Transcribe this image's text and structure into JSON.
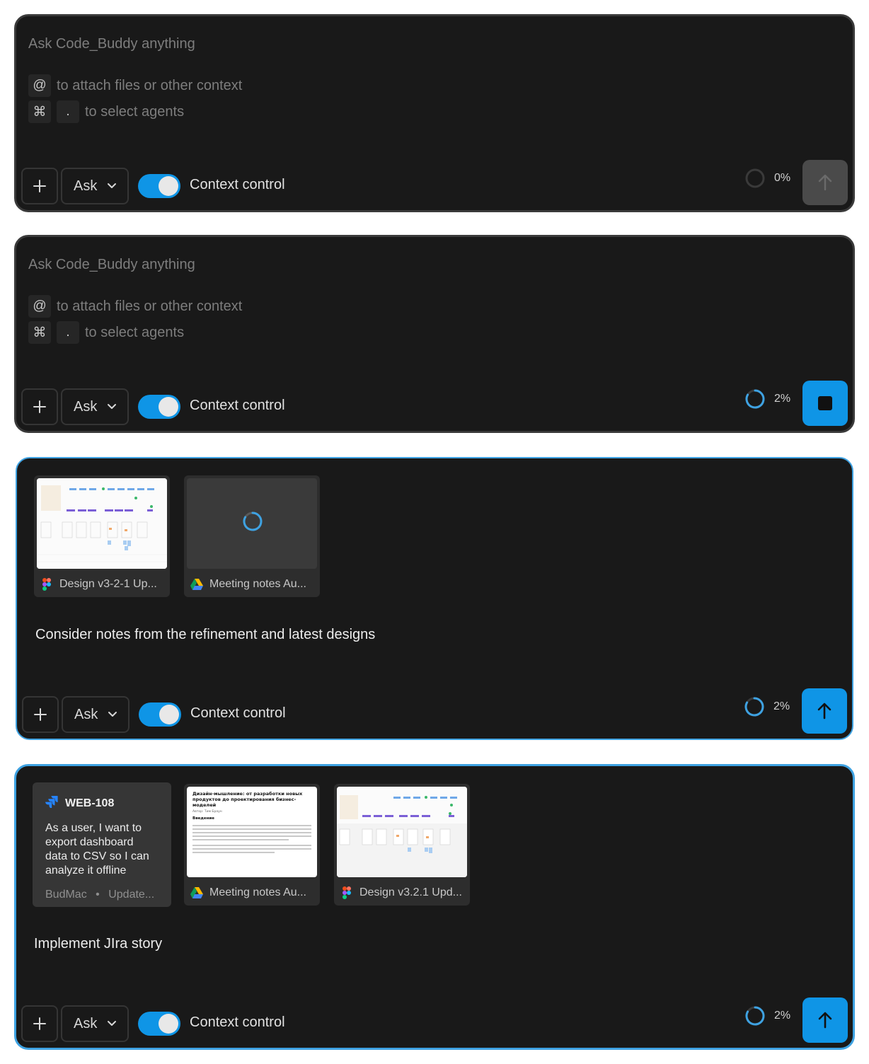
{
  "common": {
    "placeholder": "Ask Code_Buddy anything",
    "hint_attach_key": "@",
    "hint_attach_text": "to attach files or other context",
    "hint_agents_key1": "⌘",
    "hint_agents_key2": ".",
    "hint_agents_text": "to select agents",
    "mode_label": "Ask",
    "toggle_label": "Context control",
    "toggle_on": true
  },
  "panels": [
    {
      "state": "idle",
      "context_usage": "0%",
      "send_state": "disabled"
    },
    {
      "state": "generating",
      "context_usage": "2%",
      "send_state": "stop"
    },
    {
      "state": "composing",
      "attachments": [
        {
          "type": "figma",
          "label": "Design v3-2-1 Up..."
        },
        {
          "type": "gdrive",
          "label": "Meeting notes Au...",
          "loading": true
        }
      ],
      "message": "Consider notes from the refinement and latest designs",
      "context_usage": "2%",
      "send_state": "active"
    },
    {
      "state": "composing",
      "jira": {
        "key": "WEB-108",
        "summary": "As a user, I want to export dashboard data to CSV so I can analyze it offline",
        "project": "BudMac",
        "status": "Update..."
      },
      "attachments": [
        {
          "type": "gdrive",
          "label": "Meeting notes Au...",
          "doc_title": "Дизайн-мышление: от разработки новых продуктов до проектирования бизнес-моделей",
          "doc_author": "Автор: Тим Браун",
          "doc_heading": "Введение"
        },
        {
          "type": "figma",
          "label": "Design v3.2.1 Upd..."
        }
      ],
      "message": "Implement JIra story",
      "context_usage": "2%",
      "send_state": "active"
    }
  ],
  "colors": {
    "panel_bg": "#191919",
    "accent": "#0f95e6",
    "focus_border": "#3ea2e2"
  }
}
